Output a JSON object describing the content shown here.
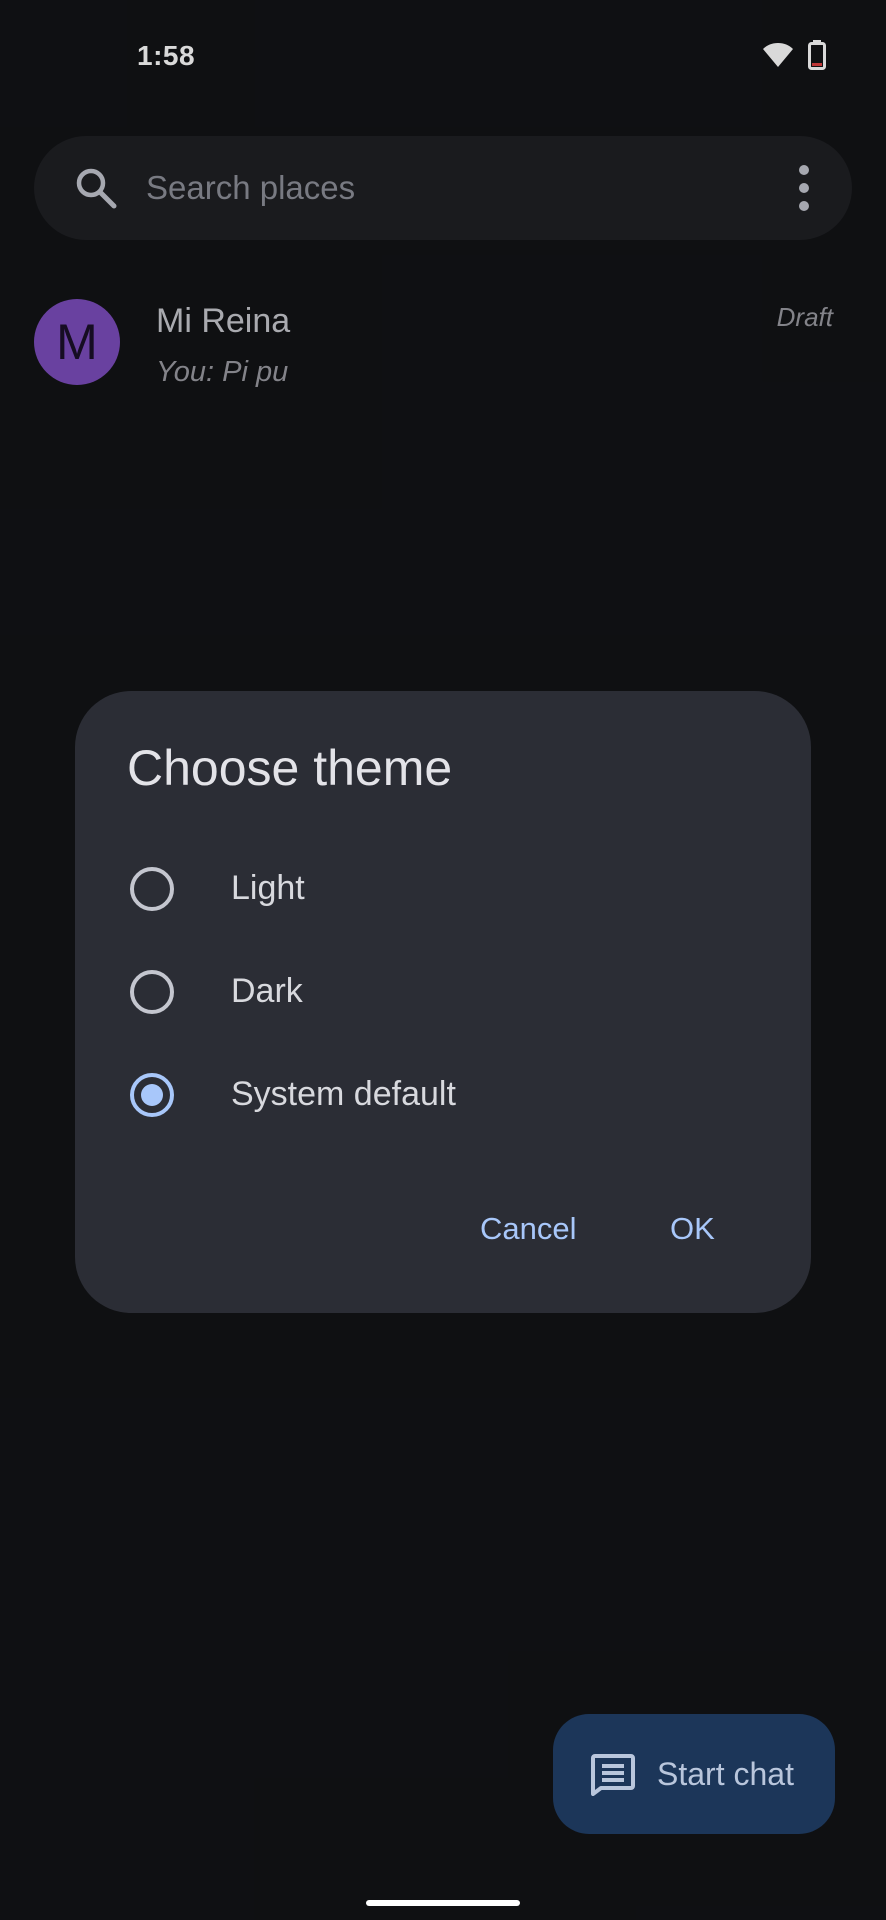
{
  "status_bar": {
    "time": "1:58",
    "icons": [
      "wifi-icon",
      "battery-icon"
    ]
  },
  "search": {
    "placeholder": "Search places",
    "value": ""
  },
  "conversations": [
    {
      "avatar_letter": "M",
      "avatar_color": "#7c4dbd",
      "name": "Mi Reina",
      "snippet": "You: Pi pu",
      "status": "Draft"
    }
  ],
  "dialog": {
    "title": "Choose theme",
    "options": [
      {
        "label": "Light",
        "selected": false
      },
      {
        "label": "Dark",
        "selected": false
      },
      {
        "label": "System default",
        "selected": true
      }
    ],
    "cancel_label": "Cancel",
    "ok_label": "OK"
  },
  "fab": {
    "label": "Start chat",
    "icon": "message-icon"
  },
  "colors": {
    "background": "#121316",
    "surface": "#2b2d35",
    "accent": "#a8c7fa",
    "fab": "#1c3659"
  }
}
